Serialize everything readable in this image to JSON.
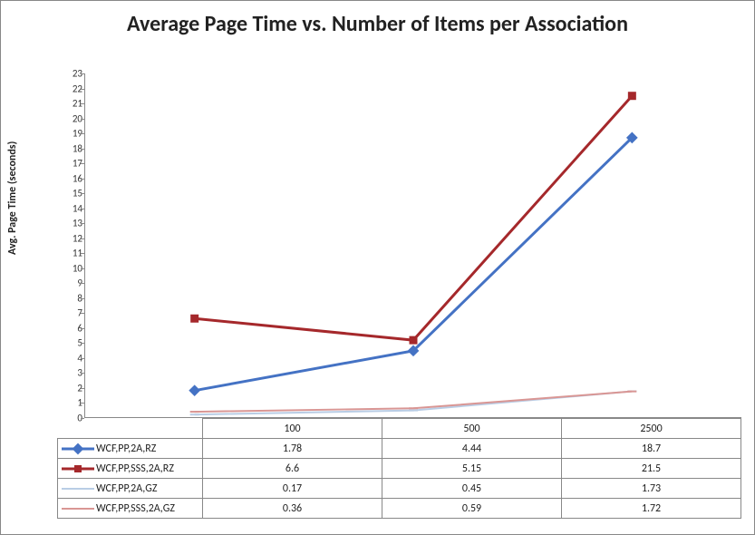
{
  "chart_data": {
    "type": "line",
    "title": "Average Page Time vs. Number of Items per Association",
    "ylabel": "Avg. Page Time (seconds)",
    "xlabel": "",
    "categories": [
      "100",
      "500",
      "2500"
    ],
    "ylim": [
      0,
      23
    ],
    "yticks": [
      0,
      1,
      2,
      3,
      4,
      5,
      6,
      7,
      8,
      9,
      10,
      11,
      12,
      13,
      14,
      15,
      16,
      17,
      18,
      19,
      20,
      21,
      22,
      23
    ],
    "series": [
      {
        "name": "WCF,PP,2A,RZ",
        "values": [
          1.78,
          4.44,
          18.7
        ],
        "color": "#4472c4",
        "marker": "diamond",
        "thick": 3
      },
      {
        "name": "WCF,PP,SSS,2A,RZ",
        "values": [
          6.6,
          5.15,
          21.5
        ],
        "color": "#a5282b",
        "marker": "square",
        "thick": 3
      },
      {
        "name": "WCF,PP,2A,GZ",
        "values": [
          0.17,
          0.45,
          1.73
        ],
        "color": "#b9cde5",
        "marker": "hline",
        "thick": 2
      },
      {
        "name": "WCF,PP,SSS,2A,GZ",
        "values": [
          0.36,
          0.59,
          1.72
        ],
        "color": "#d99694",
        "marker": "hline",
        "thick": 2
      }
    ]
  }
}
